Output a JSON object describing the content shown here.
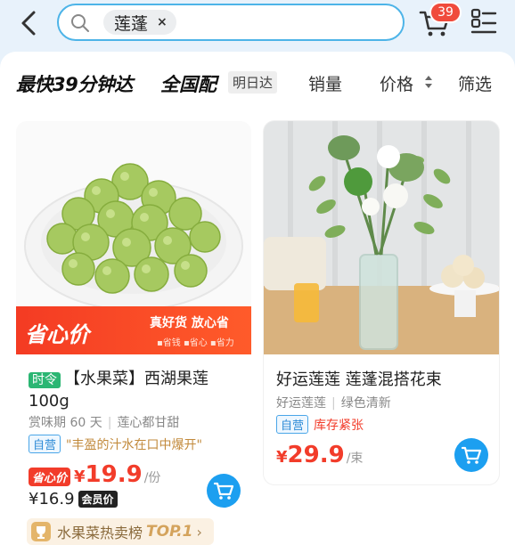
{
  "header": {
    "search_chip": "莲蓬",
    "search_chip_close": "×",
    "cart_badge": "39"
  },
  "filters": {
    "fast": "最快39分钟达",
    "nation": "全国配",
    "nextday": "明日达",
    "sales": "销量",
    "price": "价格",
    "filter": "筛选"
  },
  "products": [
    {
      "promo_main": "省心价",
      "promo_sub": "真好货 放心省",
      "promo_tags": "▪省钱 ▪省心 ▪省力",
      "season_tag": "时令",
      "title": "【水果菜】西湖果莲100g",
      "meta_a": "赏味期 60 天",
      "meta_b": "莲心都甘甜",
      "self_tag": "自营",
      "quote": "\"丰盈的汁水在口中爆开\"",
      "price_tag": "省心价",
      "price_yen": "¥",
      "price_value": "19.9",
      "price_unit": "/份",
      "member_price": "¥16.9",
      "member_tag": "会员价",
      "rank_text": "水果菜热卖榜",
      "rank_top": "TOP.1",
      "rank_arrow": "›"
    },
    {
      "title": "好运莲莲 莲蓬混搭花束",
      "meta_a": "好运莲莲",
      "meta_b": "绿色清新",
      "self_tag": "自营",
      "stock": "库存紧张",
      "price_yen": "¥",
      "price_value": "29.9",
      "price_unit": "/束"
    }
  ],
  "colors": {
    "accent_blue": "#1c9ff0",
    "price_red": "#f23c2a",
    "search_border": "#4db4e8"
  }
}
